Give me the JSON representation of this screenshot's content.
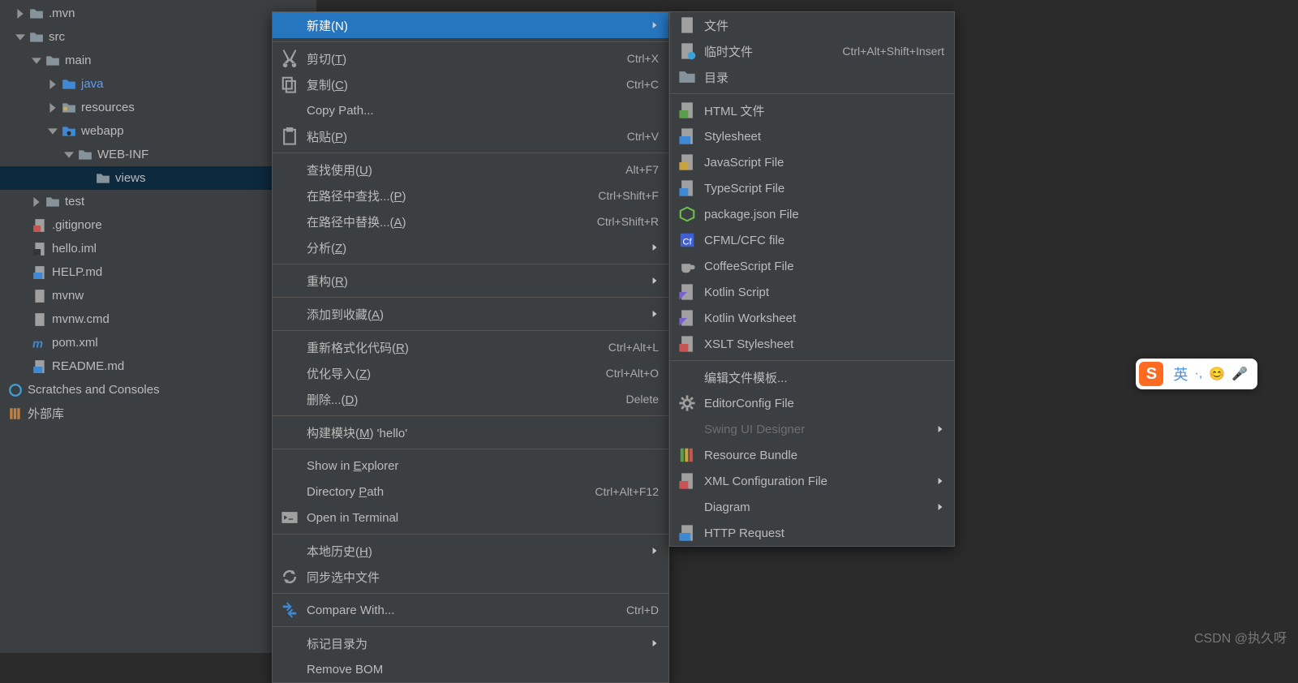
{
  "tree": {
    "mvn": ".mvn",
    "src": "src",
    "main": "main",
    "java": "java",
    "resources": "resources",
    "webapp": "webapp",
    "webinf": "WEB-INF",
    "views": "views",
    "test": "test",
    "gitignore": ".gitignore",
    "helloiml": "hello.iml",
    "helpmd": "HELP.md",
    "mvnw": "mvnw",
    "mvnwcmd": "mvnw.cmd",
    "pomxml": "pom.xml",
    "readme": "README.md",
    "scratches": "Scratches and Consoles",
    "extlib": "外部库"
  },
  "ctx1": {
    "new": "新建(N)",
    "cut": "剪切(T)",
    "cut_s": "Ctrl+X",
    "copy": "复制(C)",
    "copy_s": "Ctrl+C",
    "copypath": "Copy Path...",
    "paste": "粘贴(P)",
    "paste_s": "Ctrl+V",
    "findusages": "查找使用(U)",
    "findusages_s": "Alt+F7",
    "findinpath": "在路径中查找...(P)",
    "findinpath_s": "Ctrl+Shift+F",
    "replaceinpath": "在路径中替换...(A)",
    "replaceinpath_s": "Ctrl+Shift+R",
    "analyze": "分析(Z)",
    "refactor": "重构(R)",
    "addfav": "添加到收藏(A)",
    "reformat": "重新格式化代码(R)",
    "reformat_s": "Ctrl+Alt+L",
    "optimize": "优化导入(Z)",
    "optimize_s": "Ctrl+Alt+O",
    "delete": "删除...(D)",
    "delete_s": "Delete",
    "build": "构建模块(M) 'hello'",
    "showexp": "Show in Explorer",
    "dirpath": "Directory Path",
    "dirpath_s": "Ctrl+Alt+F12",
    "terminal": "Open in Terminal",
    "localhist": "本地历史(H)",
    "sync": "同步选中文件",
    "compare": "Compare With...",
    "compare_s": "Ctrl+D",
    "markdir": "标记目录为",
    "removebom": "Remove BOM"
  },
  "ctx2": {
    "file": "文件",
    "scratch": "临时文件",
    "scratch_s": "Ctrl+Alt+Shift+Insert",
    "dir": "目录",
    "html": "HTML 文件",
    "css": "Stylesheet",
    "js": "JavaScript File",
    "ts": "TypeScript File",
    "pkgjson": "package.json File",
    "cfml": "CFML/CFC file",
    "coffee": "CoffeeScript File",
    "kts": "Kotlin Script",
    "ktws": "Kotlin Worksheet",
    "xslt": "XSLT Stylesheet",
    "edittpl": "编辑文件模板...",
    "editorconfig": "EditorConfig File",
    "swing": "Swing UI Designer",
    "resbundle": "Resource Bundle",
    "xmlcfg": "XML Configuration File",
    "diagram": "Diagram",
    "http": "HTTP Request"
  },
  "ime": {
    "lang": "英",
    "comma": "·,",
    "emoji": "😊",
    "mic": "🎤"
  },
  "watermark": "CSDN @执久呀"
}
